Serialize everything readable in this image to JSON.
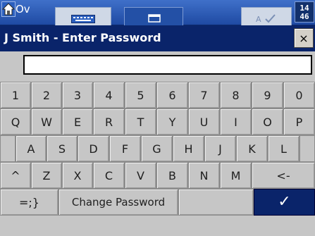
{
  "taskbar": {
    "title": "Ov",
    "clock": [
      "14",
      "46"
    ],
    "icons": {
      "home": "home-icon",
      "task1": "keyboard-icon",
      "task2": "window-icon",
      "task3": "check-icon"
    }
  },
  "dialog": {
    "title": "J Smith - Enter Password",
    "close_label": "×",
    "password_value": ""
  },
  "keyboard": {
    "row1": [
      "1",
      "2",
      "3",
      "4",
      "5",
      "6",
      "7",
      "8",
      "9",
      "0"
    ],
    "row2": [
      "Q",
      "W",
      "E",
      "R",
      "T",
      "Y",
      "U",
      "I",
      "O",
      "P"
    ],
    "row3": [
      "A",
      "S",
      "D",
      "F",
      "G",
      "H",
      "J",
      "K",
      "L"
    ],
    "row4": {
      "shift": "^",
      "letters": [
        "Z",
        "X",
        "C",
        "V",
        "B",
        "N",
        "M"
      ],
      "backspace": "<-"
    },
    "row5": {
      "symbols": "=;}",
      "change_password": "Change Password",
      "enter": "✓"
    }
  },
  "colors": {
    "taskbar": "#2a58b5",
    "title_bar": "#0a246a",
    "dialog_bg": "#c6c6c6",
    "enter_key": "#0a246a"
  }
}
